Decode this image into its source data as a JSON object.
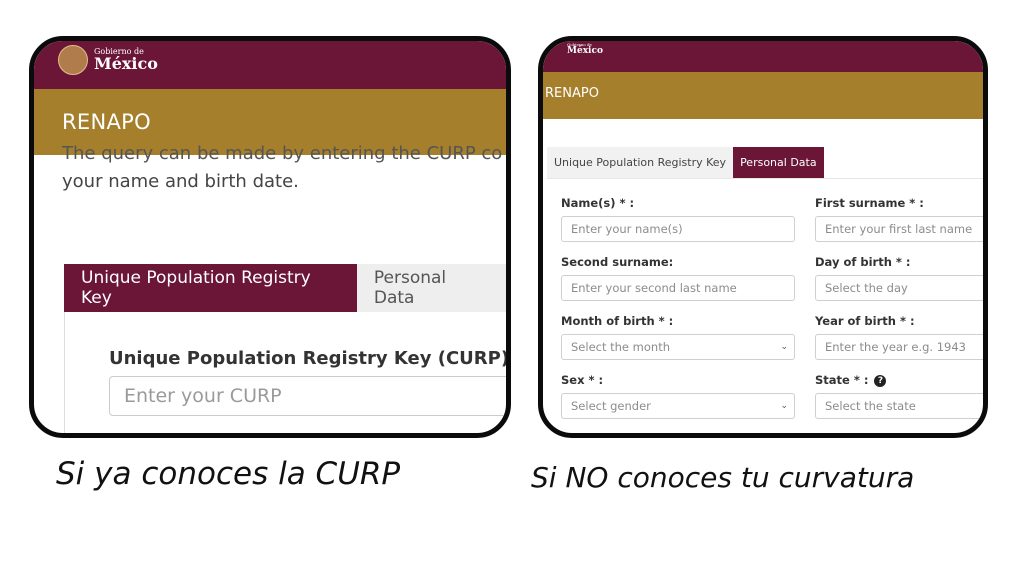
{
  "brand": {
    "gov_small": "Gobierno de",
    "gov_big": "México",
    "office": "RENAPO",
    "colors": {
      "maroon": "#6b1636",
      "gold": "#a57f2c"
    }
  },
  "left": {
    "intro_cut": "The query can be made by entering the CURP co",
    "intro_line": "your name and birth date.",
    "tabs": [
      "Unique Population Registry Key",
      "Personal Data"
    ],
    "curp_label": "Unique Population Registry Key (CURP) *",
    "curp_placeholder": "Enter your CURP",
    "caption": "Si ya conoces la CURP"
  },
  "right": {
    "tabs": [
      "Unique Population Registry Key",
      "Personal Data"
    ],
    "fields": {
      "names": {
        "label": "Name(s) * :",
        "placeholder": "Enter your name(s)"
      },
      "first_surname": {
        "label": "First surname * :",
        "placeholder": "Enter your first last name"
      },
      "second_surname": {
        "label": "Second surname:",
        "placeholder": "Enter your second last name"
      },
      "day": {
        "label": "Day of birth * :",
        "placeholder": "Select the day"
      },
      "month": {
        "label": "Month of birth * :",
        "placeholder": "Select the month"
      },
      "year": {
        "label": "Year of birth * :",
        "placeholder": "Enter the year e.g. 1943"
      },
      "sex": {
        "label": "Sex * :",
        "placeholder": "Select gender"
      },
      "state": {
        "label": "State * :",
        "placeholder": "Select the state"
      }
    },
    "caption": "Si NO conoces tu curvatura"
  },
  "icons": {
    "dropdown": "chevron-down-icon",
    "help": "question-circle-icon",
    "seal": "coat-of-arms-icon"
  }
}
